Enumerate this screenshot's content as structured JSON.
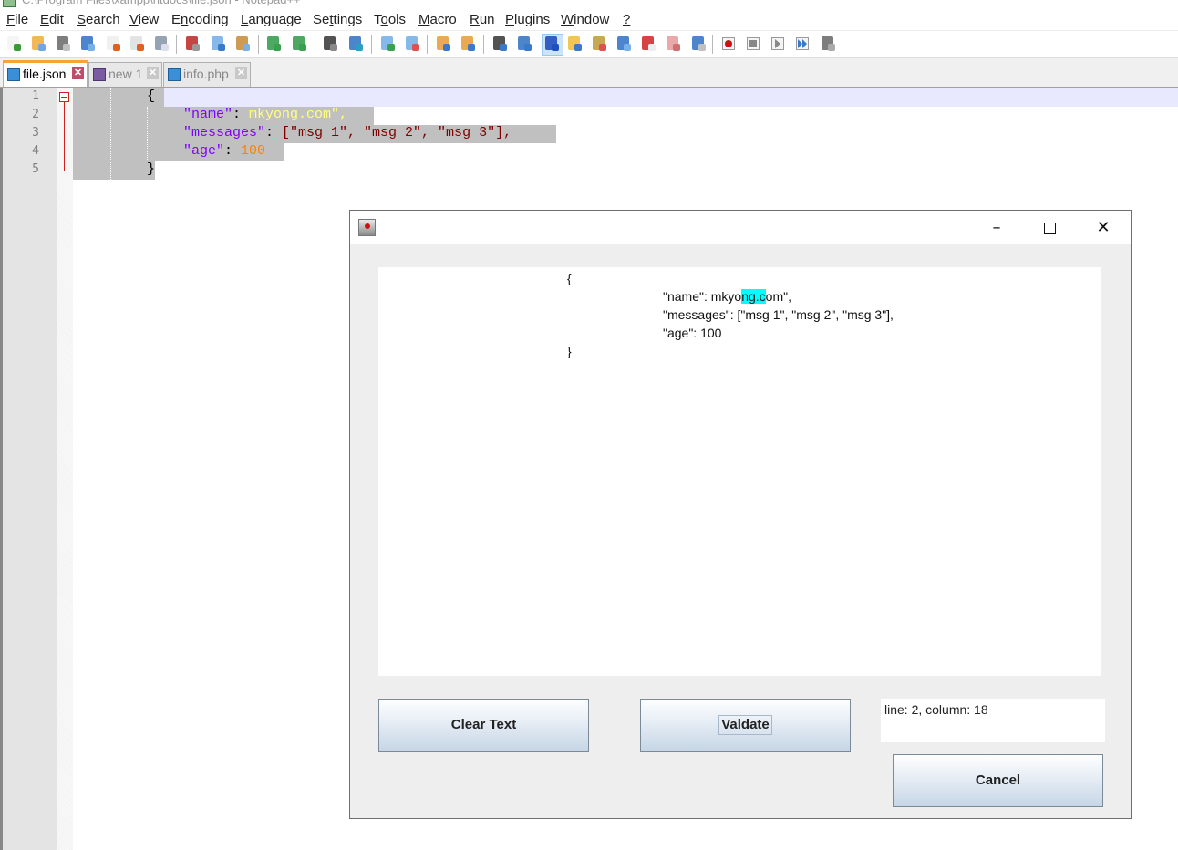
{
  "window": {
    "title": "C:\\Program Files\\xampp\\htdocs\\file.json - Notepad++"
  },
  "menu": {
    "items": [
      {
        "label": "File",
        "u": "F",
        "rest": "ile"
      },
      {
        "label": "Edit",
        "u": "E",
        "rest": "dit"
      },
      {
        "label": "Search",
        "u": "S",
        "rest": "earch"
      },
      {
        "label": "View",
        "u": "V",
        "rest": "iew"
      },
      {
        "label": "Encoding",
        "pre": "E",
        "u": "n",
        "rest": "coding"
      },
      {
        "label": "Language",
        "u": "L",
        "rest": "anguage"
      },
      {
        "label": "Settings",
        "pre": "Se",
        "u": "t",
        "rest": "tings"
      },
      {
        "label": "Tools",
        "pre": "T",
        "u": "o",
        "rest": "ols"
      },
      {
        "label": "Macro",
        "u": "M",
        "rest": "acro"
      },
      {
        "label": "Run",
        "u": "R",
        "rest": "un"
      },
      {
        "label": "Plugins",
        "u": "P",
        "rest": "lugins"
      },
      {
        "label": "Window",
        "u": "W",
        "rest": "indow"
      },
      {
        "label": "?",
        "u": "?",
        "rest": ""
      }
    ]
  },
  "toolbar": {
    "icons": [
      "new-file",
      "open-file",
      "save",
      "save-all",
      "close",
      "close-all",
      "print",
      "cut",
      "copy",
      "paste",
      "undo",
      "redo",
      "find",
      "replace",
      "zoom-in",
      "zoom-out",
      "sync-vertical",
      "sync-horizontal",
      "word-wrap",
      "show-all-chars",
      "indent-guide",
      "udl",
      "document-map",
      "document-list",
      "function-list",
      "folder-as-workspace",
      "monitoring",
      "macro-record",
      "macro-stop",
      "macro-play",
      "macro-run-multiple",
      "macro-save"
    ],
    "selected": "indent-guide"
  },
  "tabs": [
    {
      "label": "file.json",
      "active": true,
      "icon_color": "#3b8fd6"
    },
    {
      "label": "new 1",
      "active": false,
      "icon_color": "#7a5aa0"
    },
    {
      "label": "info.php",
      "active": false,
      "icon_color": "#3b8fd6"
    }
  ],
  "editor": {
    "line_numbers": [
      "1",
      "2",
      "3",
      "4",
      "5"
    ],
    "lines": [
      {
        "open_brace": "{"
      },
      {
        "key": "\"name\"",
        "colon": ": ",
        "value": "mkyong.com\","
      },
      {
        "key": "\"messages\"",
        "colon": ": ",
        "value": "[\"msg 1\", \"msg 2\", \"msg 3\"],"
      },
      {
        "key": "\"age\"",
        "colon": ": ",
        "value": "100"
      },
      {
        "close_brace": "}"
      }
    ]
  },
  "dialog": {
    "title": "",
    "content_lines": [
      "{",
      "\"name\": mkyo",
      "ng.c",
      "om\",",
      "\"messages\": [\"msg 1\", \"msg 2\", \"msg 3\"],",
      "\"age\": 100",
      "}"
    ],
    "clear_label": "Clear Text",
    "validate_label": "Valdate",
    "cancel_label": "Cancel",
    "status": "line: 2, column: 18",
    "minimize": "–",
    "maximize": "□",
    "close": "✕"
  }
}
